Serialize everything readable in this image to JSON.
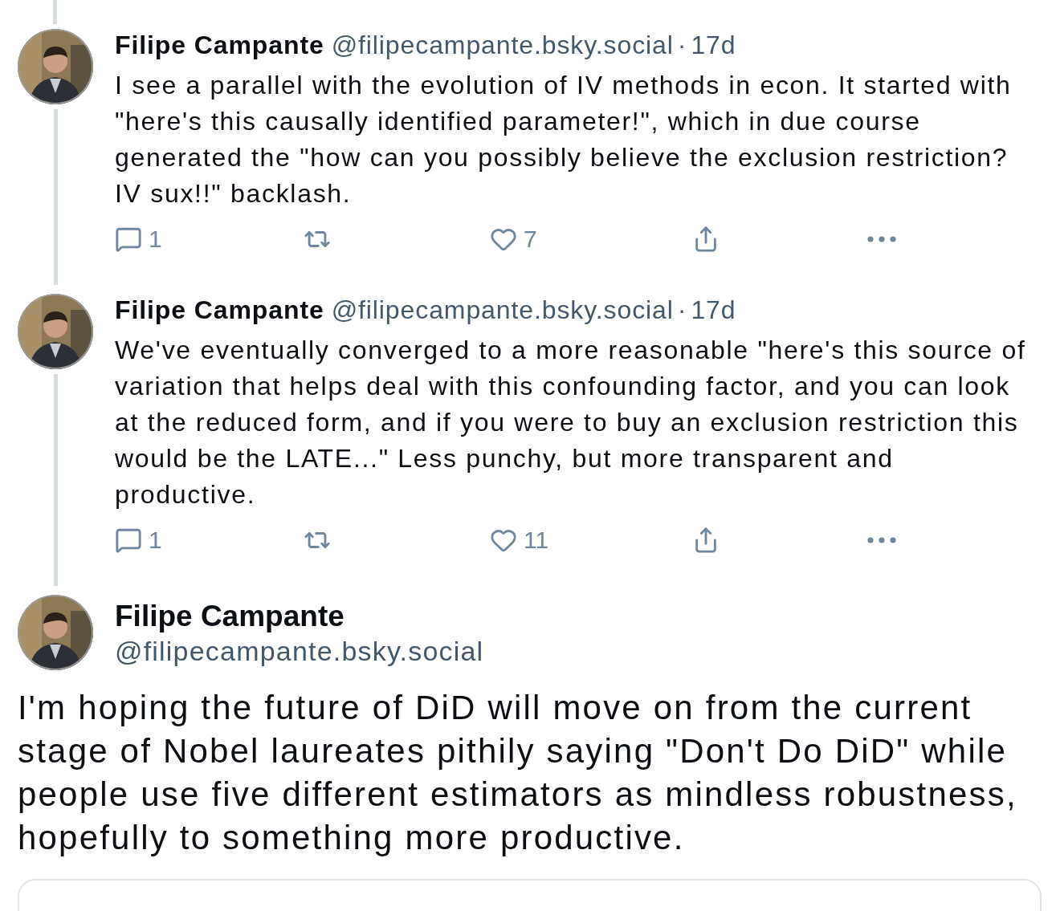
{
  "replies": [
    {
      "author": "Filipe Campante",
      "handle": "@filipecampante.bsky.social",
      "separator": "·",
      "time": "17d",
      "text": "I see a parallel with the evolution of IV methods in econ. It started with \"here's this causally identified parameter!\", which in due course generated the \"how can you possibly believe the exclusion restriction? IV sux!!\" backlash.",
      "actions": [
        {
          "kind": "reply",
          "count": "1"
        },
        {
          "kind": "repost"
        },
        {
          "kind": "like",
          "count": "7"
        },
        {
          "kind": "share"
        },
        {
          "kind": "more"
        }
      ]
    },
    {
      "author": "Filipe Campante",
      "handle": "@filipecampante.bsky.social",
      "separator": "·",
      "time": "17d",
      "text": "We've eventually converged to a more reasonable \"here's this source of variation that helps deal with this confounding factor, and you can look at the reduced form, and if you were to buy an exclusion restriction this would be the LATE...\" Less punchy, but more transparent and productive.",
      "actions": [
        {
          "kind": "reply",
          "count": "1"
        },
        {
          "kind": "repost"
        },
        {
          "kind": "like",
          "count": "11"
        },
        {
          "kind": "share"
        },
        {
          "kind": "more"
        }
      ]
    }
  ],
  "main_post": {
    "author": "Filipe Campante",
    "handle": "@filipecampante.bsky.social",
    "text": "I'm hoping the future of DiD will move on from the current stage of Nobel laureates pithily saying \"Don't Do DiD\" while people use five different estimators as mindless robustness, hopefully to something more productive.",
    "quoted_post": {
      "kind": "card"
    }
  }
}
